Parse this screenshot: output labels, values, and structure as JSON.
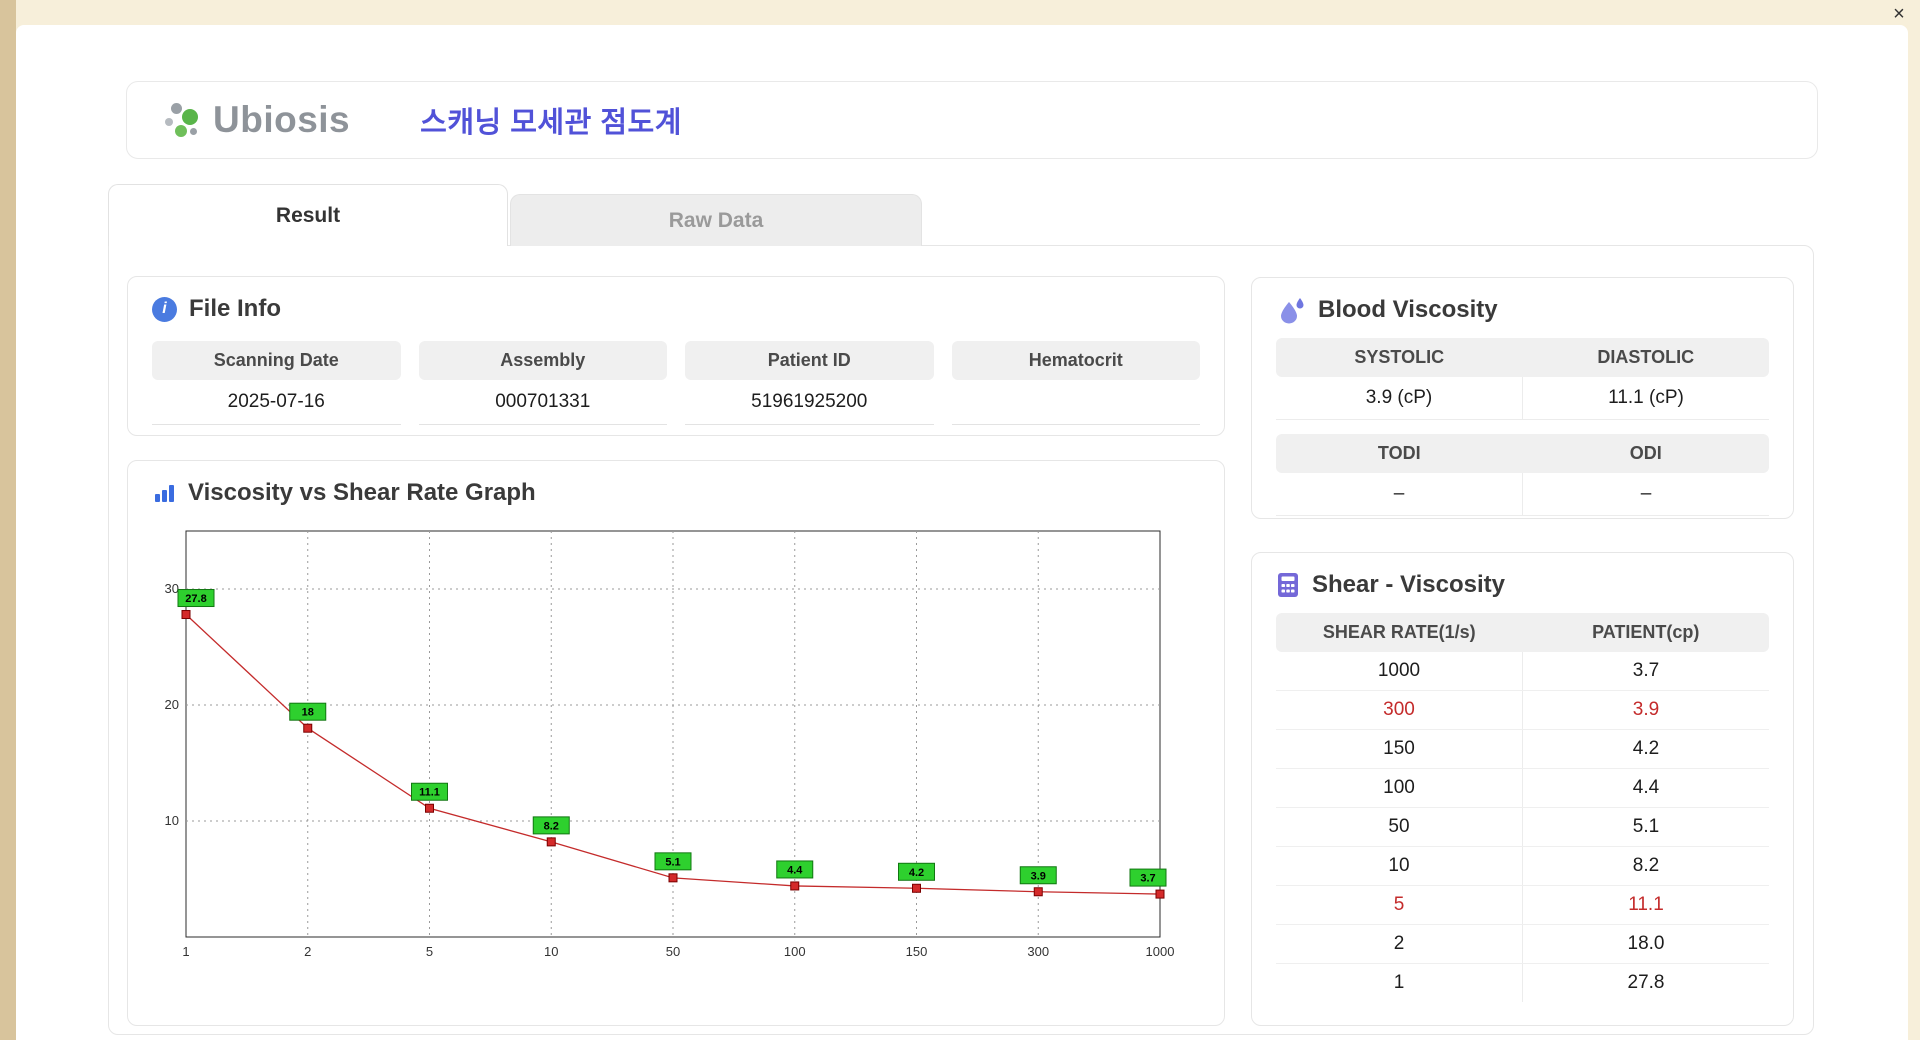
{
  "window": {
    "close_icon": "×"
  },
  "header": {
    "logo_text": "Ubiosis",
    "title": "스캐닝 모세관 점도계"
  },
  "tabs": [
    {
      "label": "Result",
      "active": true
    },
    {
      "label": "Raw Data",
      "active": false
    }
  ],
  "file_info": {
    "title": "File Info",
    "fields": [
      {
        "label": "Scanning Date",
        "value": "2025-07-16"
      },
      {
        "label": "Assembly",
        "value": "000701331"
      },
      {
        "label": "Patient ID",
        "value": "51961925200"
      },
      {
        "label": "Hematocrit",
        "value": ""
      }
    ]
  },
  "graph": {
    "title": "Viscosity vs Shear Rate Graph"
  },
  "chart_data": {
    "type": "line",
    "title": "Viscosity vs Shear Rate Graph",
    "x": [
      "1",
      "2",
      "5",
      "10",
      "50",
      "100",
      "150",
      "300",
      "1000"
    ],
    "values": [
      27.8,
      18,
      11.1,
      8.2,
      5.1,
      4.4,
      4.2,
      3.9,
      3.7
    ],
    "point_labels": [
      "27.8",
      "18",
      "11.1",
      "8.2",
      "5.1",
      "4.4",
      "4.2",
      "3.9",
      "3.7"
    ],
    "xlabel": "",
    "ylabel": "",
    "yticks": [
      10,
      20,
      30
    ],
    "ylim": [
      0,
      35
    ],
    "x_scale": "categorical-equal-spacing",
    "grid": true,
    "legend": false,
    "line_color": "#c42b2b",
    "marker_color": "#d42a2a",
    "marker_border": "#7a0000",
    "label_bg": "#2ed02e",
    "label_border": "#117711"
  },
  "blood_viscosity": {
    "title": "Blood Viscosity",
    "cells": [
      {
        "label": "SYSTOLIC",
        "value": "3.9 (cP)"
      },
      {
        "label": "DIASTOLIC",
        "value": "11.1 (cP)"
      },
      {
        "label": "TODI",
        "value": "–"
      },
      {
        "label": "ODI",
        "value": "–"
      }
    ]
  },
  "shear_viscosity": {
    "title": "Shear - Viscosity",
    "columns": [
      "SHEAR RATE(1/s)",
      "PATIENT(cp)"
    ],
    "rows": [
      {
        "shear": "1000",
        "patient": "3.7",
        "highlight": false
      },
      {
        "shear": "300",
        "patient": "3.9",
        "highlight": true
      },
      {
        "shear": "150",
        "patient": "4.2",
        "highlight": false
      },
      {
        "shear": "100",
        "patient": "4.4",
        "highlight": false
      },
      {
        "shear": "50",
        "patient": "5.1",
        "highlight": false
      },
      {
        "shear": "10",
        "patient": "8.2",
        "highlight": false
      },
      {
        "shear": "5",
        "patient": "11.1",
        "highlight": true
      },
      {
        "shear": "2",
        "patient": "18.0",
        "highlight": false
      },
      {
        "shear": "1",
        "patient": "27.8",
        "highlight": false
      }
    ]
  },
  "colors": {
    "accent": "#5152d8",
    "highlight_red": "#c42b2b",
    "marker_green": "#2ed02e",
    "line_red": "#c42b2b"
  }
}
